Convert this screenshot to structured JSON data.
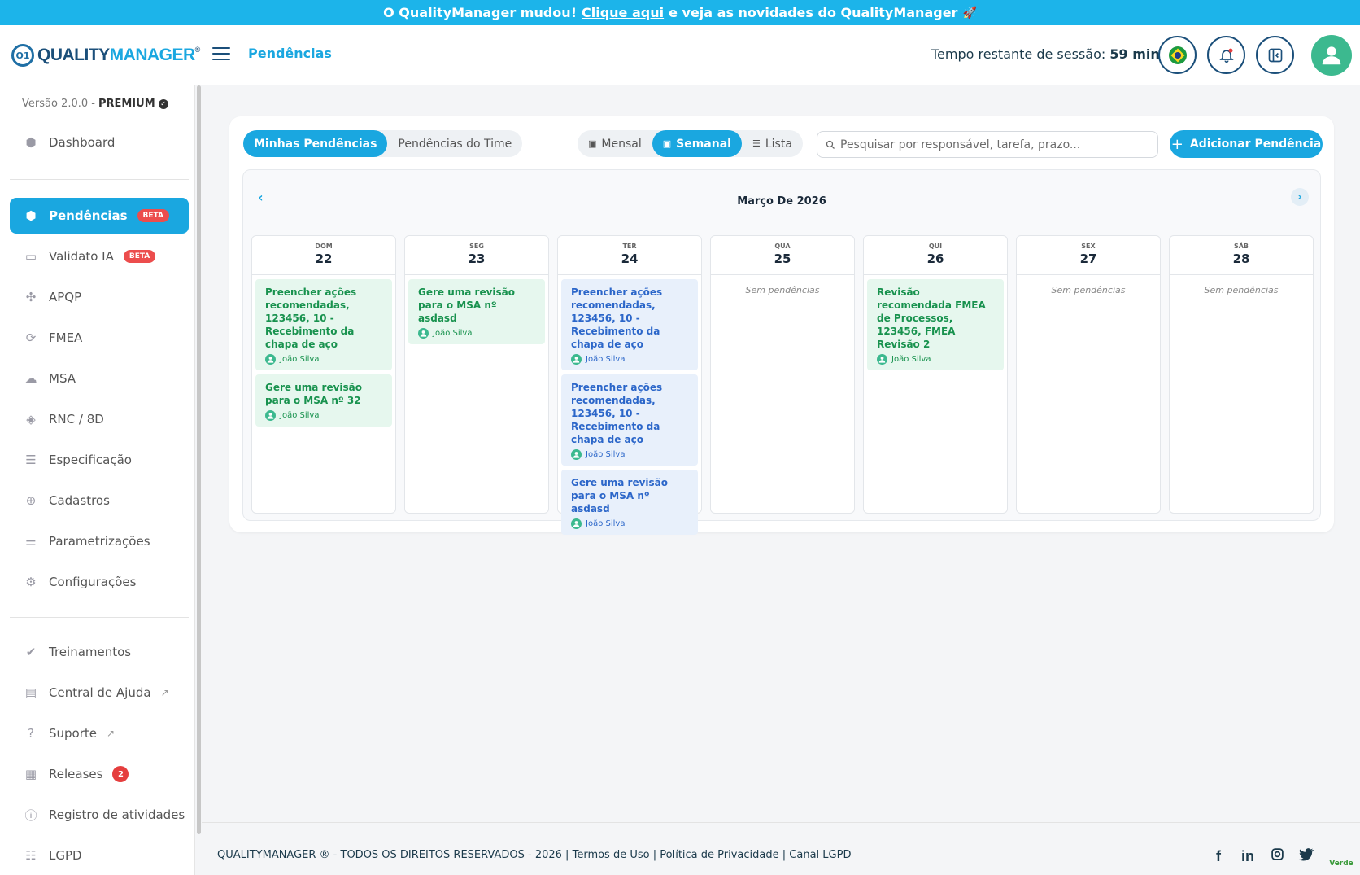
{
  "banner": {
    "pre": "O QualityManager mudou!",
    "link": "Clique aqui",
    "post": "e veja as novidades do QualityManager",
    "emoji": "🚀"
  },
  "header": {
    "logo_mark": "O1",
    "logo_quality": "QUALITY",
    "logo_manager": "MANAGER",
    "logo_reg": "®",
    "page_title": "Pendências",
    "session_label": "Tempo restante de sessão:",
    "session_value": "59 min",
    "icons": [
      "brazil-flag-icon",
      "bell-icon",
      "sidebar-toggle-icon",
      "user-icon"
    ]
  },
  "sidebar": {
    "version": "Versão 2.0.0 -",
    "plan": "PREMIUM",
    "items": [
      {
        "label": "Dashboard",
        "icon": "home-icon"
      },
      {
        "label": "Pendências",
        "icon": "alert-icon",
        "badge": "BETA"
      },
      {
        "label": "Validato IA",
        "icon": "chat-icon",
        "badge": "BETA"
      },
      {
        "label": "APQP",
        "icon": "grid-icon"
      },
      {
        "label": "FMEA",
        "icon": "fmea-icon"
      },
      {
        "label": "MSA",
        "icon": "msa-icon"
      },
      {
        "label": "RNC / 8D",
        "icon": "layers-icon"
      },
      {
        "label": "Especificação",
        "icon": "list-icon"
      },
      {
        "label": "Cadastros",
        "icon": "plus-circle-icon"
      },
      {
        "label": "Parametrizações",
        "icon": "sliders-icon"
      },
      {
        "label": "Configurações",
        "icon": "gear-icon"
      },
      {
        "label": "Treinamentos",
        "icon": "check-circle-icon"
      },
      {
        "label": "Central de Ajuda",
        "icon": "book-icon"
      },
      {
        "label": "Suporte",
        "icon": "question-icon"
      },
      {
        "label": "Releases",
        "icon": "apps-icon",
        "count": "2"
      },
      {
        "label": "Registro de atividades",
        "icon": "info-icon"
      },
      {
        "label": "LGPD",
        "icon": "checklist-icon"
      }
    ]
  },
  "toolbar": {
    "tab_mine": "Minhas Pendências",
    "tab_team": "Pendências do Time",
    "view_monthly": "Mensal",
    "view_weekly": "Semanal",
    "view_list": "Lista",
    "search_placeholder": "Pesquisar por responsável, tarefa, prazo...",
    "add_button": "Adicionar Pendência"
  },
  "calendar": {
    "month": "Março De 2026",
    "empty_text": "Sem pendências",
    "days": [
      {
        "dow": "DOM",
        "num": "22",
        "tasks": [
          {
            "title": "Preencher ações recomendadas, 123456, 10 - Recebimento da chapa de aço",
            "user": "João Silva",
            "color": "green"
          },
          {
            "title": "Gere uma revisão para o MSA nº 32",
            "user": "João Silva",
            "color": "green"
          }
        ]
      },
      {
        "dow": "SEG",
        "num": "23",
        "tasks": [
          {
            "title": "Gere uma revisão para o MSA nº asdasd",
            "user": "João Silva",
            "color": "green"
          }
        ]
      },
      {
        "dow": "TER",
        "num": "24",
        "tasks": [
          {
            "title": "Preencher ações recomendadas, 123456, 10 - Recebimento da chapa de aço",
            "user": "João Silva",
            "color": "blue"
          },
          {
            "title": "Preencher ações recomendadas, 123456, 10 - Recebimento da chapa de aço",
            "user": "João Silva",
            "color": "blue"
          },
          {
            "title": "Gere uma revisão para o MSA nº asdasd",
            "user": "João Silva",
            "color": "blue"
          }
        ]
      },
      {
        "dow": "QUA",
        "num": "25",
        "tasks": []
      },
      {
        "dow": "QUI",
        "num": "26",
        "tasks": [
          {
            "title": "Revisão recomendada FMEA de Processos, 123456, FMEA Revisão 2",
            "user": "João Silva",
            "color": "green"
          }
        ]
      },
      {
        "dow": "SEX",
        "num": "27",
        "tasks": []
      },
      {
        "dow": "SÁB",
        "num": "28",
        "tasks": []
      }
    ]
  },
  "footer": {
    "copyright": "QUALITYMANAGER ® - TODOS OS DIREITOS RESERVADOS - 2026 |",
    "terms": "Termos de Uso",
    "sep": "|",
    "privacy": "Política de Privacidade",
    "lgpd": "Canal LGPD",
    "socials": [
      "facebook-icon",
      "linkedin-icon",
      "instagram-icon",
      "twitter-icon"
    ],
    "verde_logo": "Verde"
  },
  "colors": {
    "accent": "#1aa7e0",
    "brand_dark": "#1b4f7a",
    "task_green": "#18924e",
    "task_blue": "#2b66c9",
    "badge_red": "#ec4d4d"
  }
}
